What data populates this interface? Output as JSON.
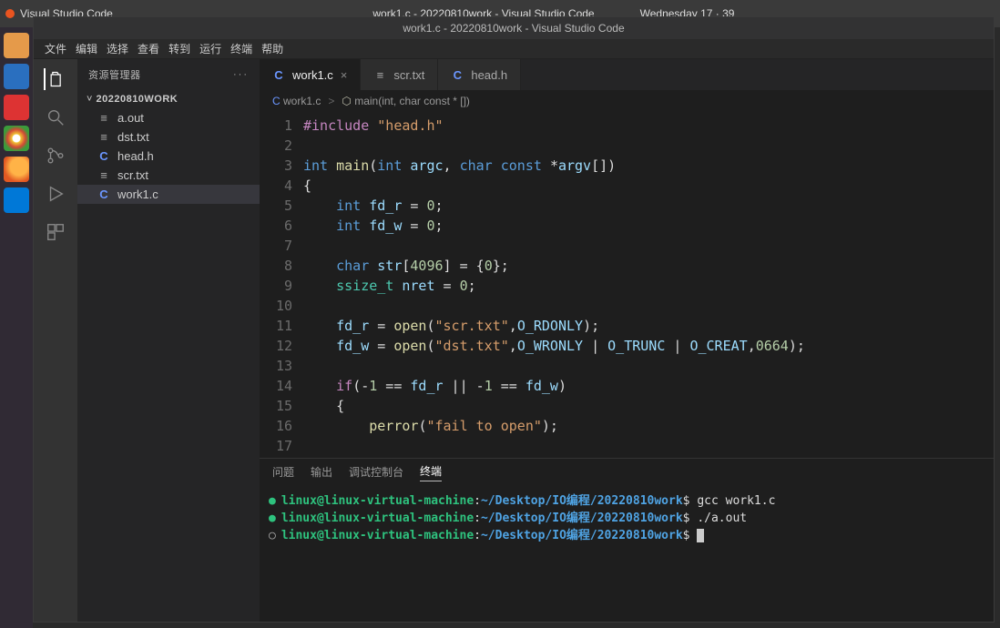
{
  "os": {
    "top_title": "Visual Studio Code",
    "date": "Wednesday 17",
    "time": "39"
  },
  "window": {
    "title": "work1.c - 20220810work - Visual Studio Code"
  },
  "menubar": {
    "items": [
      "文件",
      "编辑",
      "选择",
      "查看",
      "转到",
      "运行",
      "终端",
      "帮助"
    ]
  },
  "sidebar": {
    "title": "资源管理器",
    "folder": "20220810WORK",
    "files": [
      {
        "icon": "≡",
        "cls": "bin",
        "name": "a.out"
      },
      {
        "icon": "≡",
        "cls": "txt",
        "name": "dst.txt"
      },
      {
        "icon": "C",
        "cls": "c",
        "name": "head.h"
      },
      {
        "icon": "≡",
        "cls": "txt",
        "name": "scr.txt"
      },
      {
        "icon": "C",
        "cls": "c",
        "name": "work1.c"
      }
    ],
    "selected": "work1.c"
  },
  "tabs": [
    {
      "icon": "C",
      "cls": "c",
      "label": "work1.c",
      "active": true,
      "closable": true
    },
    {
      "icon": "≡",
      "cls": "txt",
      "label": "scr.txt",
      "active": false,
      "closable": false
    },
    {
      "icon": "C",
      "cls": "c",
      "label": "head.h",
      "active": false,
      "closable": false
    }
  ],
  "breadcrumb": {
    "parts": [
      {
        "icon": "C",
        "label": "work1.c"
      },
      {
        "icon": "⬡",
        "label": "main(int, char const * [])"
      }
    ]
  },
  "code": {
    "start_line": 1,
    "lines": [
      [
        {
          "t": "pr",
          "s": "#include "
        },
        {
          "t": "str",
          "s": "\"head.h\""
        }
      ],
      [],
      [
        {
          "t": "kw",
          "s": "int "
        },
        {
          "t": "fn",
          "s": "main"
        },
        {
          "t": "pun",
          "s": "("
        },
        {
          "t": "kw",
          "s": "int "
        },
        {
          "t": "var",
          "s": "argc"
        },
        {
          "t": "pun",
          "s": ", "
        },
        {
          "t": "kw",
          "s": "char const "
        },
        {
          "t": "pun",
          "s": "*"
        },
        {
          "t": "var",
          "s": "argv"
        },
        {
          "t": "pun",
          "s": "[])"
        }
      ],
      [
        {
          "t": "pun",
          "s": "{"
        }
      ],
      [
        {
          "t": "pun",
          "s": "    "
        },
        {
          "t": "kw",
          "s": "int "
        },
        {
          "t": "var",
          "s": "fd_r"
        },
        {
          "t": "pun",
          "s": " = "
        },
        {
          "t": "num",
          "s": "0"
        },
        {
          "t": "pun",
          "s": ";"
        }
      ],
      [
        {
          "t": "pun",
          "s": "    "
        },
        {
          "t": "kw",
          "s": "int "
        },
        {
          "t": "var",
          "s": "fd_w"
        },
        {
          "t": "pun",
          "s": " = "
        },
        {
          "t": "num",
          "s": "0"
        },
        {
          "t": "pun",
          "s": ";"
        }
      ],
      [],
      [
        {
          "t": "pun",
          "s": "    "
        },
        {
          "t": "kw",
          "s": "char "
        },
        {
          "t": "var",
          "s": "str"
        },
        {
          "t": "pun",
          "s": "["
        },
        {
          "t": "num",
          "s": "4096"
        },
        {
          "t": "pun",
          "s": "] = {"
        },
        {
          "t": "num",
          "s": "0"
        },
        {
          "t": "pun",
          "s": "};"
        }
      ],
      [
        {
          "t": "pun",
          "s": "    "
        },
        {
          "t": "type",
          "s": "ssize_t"
        },
        {
          "t": "pun",
          "s": " "
        },
        {
          "t": "var",
          "s": "nret"
        },
        {
          "t": "pun",
          "s": " = "
        },
        {
          "t": "num",
          "s": "0"
        },
        {
          "t": "pun",
          "s": ";"
        }
      ],
      [],
      [
        {
          "t": "pun",
          "s": "    "
        },
        {
          "t": "var",
          "s": "fd_r"
        },
        {
          "t": "pun",
          "s": " = "
        },
        {
          "t": "fn",
          "s": "open"
        },
        {
          "t": "pun",
          "s": "("
        },
        {
          "t": "str",
          "s": "\"scr.txt\""
        },
        {
          "t": "pun",
          "s": ","
        },
        {
          "t": "var",
          "s": "O_RDONLY"
        },
        {
          "t": "pun",
          "s": ");"
        }
      ],
      [
        {
          "t": "pun",
          "s": "    "
        },
        {
          "t": "var",
          "s": "fd_w"
        },
        {
          "t": "pun",
          "s": " = "
        },
        {
          "t": "fn",
          "s": "open"
        },
        {
          "t": "pun",
          "s": "("
        },
        {
          "t": "str",
          "s": "\"dst.txt\""
        },
        {
          "t": "pun",
          "s": ","
        },
        {
          "t": "var",
          "s": "O_WRONLY"
        },
        {
          "t": "pun",
          "s": " | "
        },
        {
          "t": "var",
          "s": "O_TRUNC"
        },
        {
          "t": "pun",
          "s": " | "
        },
        {
          "t": "var",
          "s": "O_CREAT"
        },
        {
          "t": "pun",
          "s": ","
        },
        {
          "t": "num",
          "s": "0664"
        },
        {
          "t": "pun",
          "s": ");"
        }
      ],
      [],
      [
        {
          "t": "pun",
          "s": "    "
        },
        {
          "t": "pr",
          "s": "if"
        },
        {
          "t": "pun",
          "s": "(-"
        },
        {
          "t": "num",
          "s": "1"
        },
        {
          "t": "pun",
          "s": " == "
        },
        {
          "t": "var",
          "s": "fd_r"
        },
        {
          "t": "pun",
          "s": " || -"
        },
        {
          "t": "num",
          "s": "1"
        },
        {
          "t": "pun",
          "s": " == "
        },
        {
          "t": "var",
          "s": "fd_w"
        },
        {
          "t": "pun",
          "s": ")"
        }
      ],
      [
        {
          "t": "pun",
          "s": "    {"
        }
      ],
      [
        {
          "t": "pun",
          "s": "        "
        },
        {
          "t": "fn",
          "s": "perror"
        },
        {
          "t": "pun",
          "s": "("
        },
        {
          "t": "str",
          "s": "\"fail to open\""
        },
        {
          "t": "pun",
          "s": ");"
        }
      ],
      []
    ]
  },
  "panel": {
    "tabs": [
      "问题",
      "输出",
      "调试控制台",
      "终端"
    ],
    "active": "终端"
  },
  "terminal": {
    "user": "linux@linux-virtual-machine",
    "path": "~/Desktop/IO编程/20220810work",
    "lines": [
      {
        "dot": "●",
        "cmd": "gcc work1.c"
      },
      {
        "dot": "●",
        "cmd": "./a.out"
      },
      {
        "dot": "○",
        "cmd": ""
      }
    ]
  }
}
